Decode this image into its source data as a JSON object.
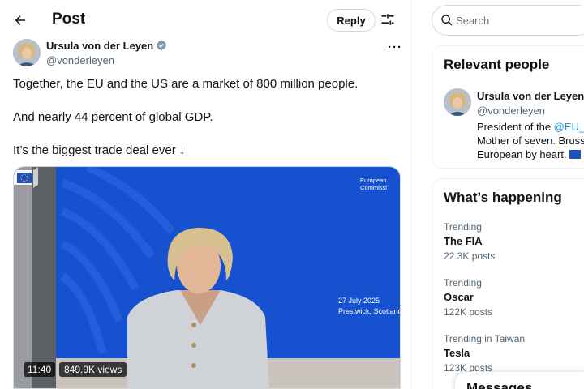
{
  "header": {
    "title": "Post",
    "reply_label": "Reply"
  },
  "post": {
    "author_name": "Ursula von der Leyen",
    "author_handle": "@vonderleyen",
    "text_lines": [
      "Together, the EU and the US are a market of 800 million people.",
      "And nearly 44 percent of global GDP.",
      "It’s the biggest trade deal ever ↓"
    ],
    "video": {
      "logo_text_line1": "European",
      "logo_text_line2": "Commissi",
      "date": "27 July 2025",
      "place": "Prestwick, Scotland",
      "duration": "11:40",
      "views": "849.9K views"
    }
  },
  "sidebar": {
    "search_placeholder": "Search",
    "relevant_people": {
      "title": "Relevant people",
      "name": "Ursula von der Leyen",
      "handle": "@vonderleyen",
      "bio_line1_prefix": "President of the ",
      "bio_line1_link": "@EU_C",
      "bio_line2": "Mother of seven. Bruss",
      "bio_line3": "European by heart."
    },
    "whats_happening": {
      "title": "What’s happening",
      "trends": [
        {
          "context": "Trending",
          "name": "The FIA",
          "count": "22.3K posts"
        },
        {
          "context": "Trending",
          "name": "Oscar",
          "count": "122K posts"
        },
        {
          "context": "Trending in Taiwan",
          "name": "Tesla",
          "count": "123K posts"
        }
      ]
    },
    "messages_title": "Messages"
  },
  "colors": {
    "accent": "#1d9bf0",
    "verified": "#829aab",
    "video_background": "#1651d0"
  },
  "icons": [
    "back-arrow-icon",
    "filter-sliders-icon",
    "verified-badge-icon",
    "more-icon",
    "search-icon",
    "eu-flag-icon"
  ]
}
